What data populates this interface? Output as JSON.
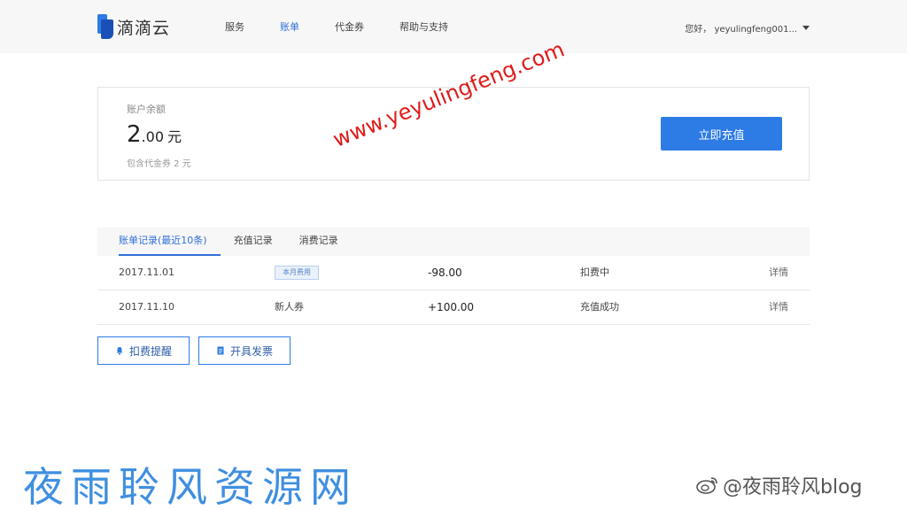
{
  "header": {
    "logo_text": "滴滴云",
    "nav": [
      "服务",
      "账单",
      "代金券",
      "帮助与支持"
    ],
    "active_nav": 1,
    "user_greeting": "您好， yeyulingfeng001..."
  },
  "balance": {
    "label": "账户余额",
    "amount_int": "2",
    "amount_dec": ".00",
    "unit": "元",
    "sub_note": "包含代金券 2 元",
    "recharge_label": "立即充值"
  },
  "tabs": [
    "账单记录(最近10条)",
    "充值记录",
    "消费记录"
  ],
  "rows": [
    {
      "date": "2017.11.01",
      "type_tag": "本月费用",
      "amount": "-98.00",
      "status": "扣费中",
      "detail": "详情"
    },
    {
      "date": "2017.11.10",
      "type": "新人券",
      "amount": "+100.00",
      "status": "充值成功",
      "detail": "详情"
    }
  ],
  "buttons": {
    "reminder": "扣费提醒",
    "invoice": "开具发票"
  },
  "watermarks": {
    "url": "www.yeyulingfeng.com",
    "site": "夜雨聆风资源网",
    "weibo": "@夜雨聆风blog"
  },
  "colors": {
    "primary": "#2d7be5",
    "active_text": "#2f6fd8",
    "watermark_red": "#e01a1a",
    "watermark_blue": "#3f8fe0"
  }
}
